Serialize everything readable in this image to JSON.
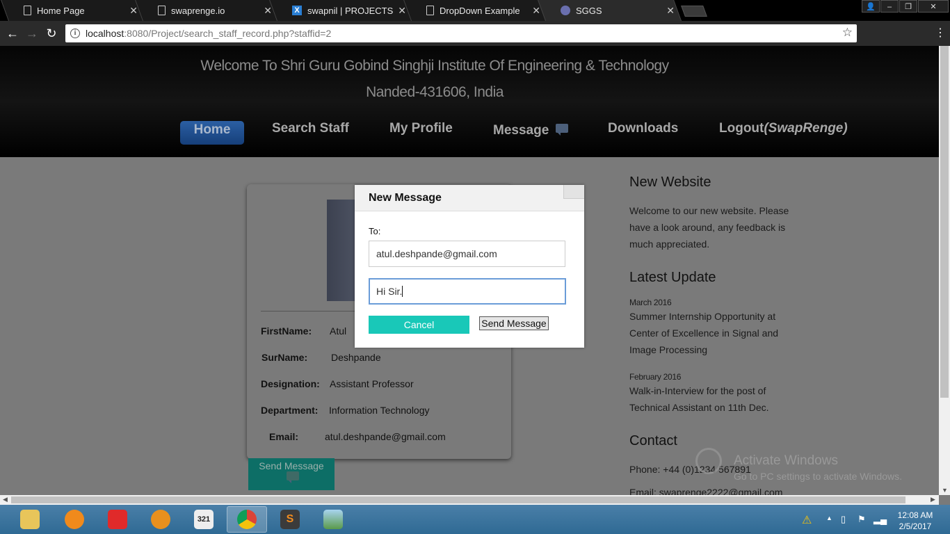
{
  "browser": {
    "tabs": [
      {
        "title": "Home Page",
        "active": false
      },
      {
        "title": "swaprenge.io",
        "active": false
      },
      {
        "title": "swapnil | PROJECTS",
        "active": false
      },
      {
        "title": "DropDown Example",
        "active": false
      },
      {
        "title": "SGGS",
        "active": true
      }
    ],
    "url_host": "localhost",
    "url_rest": ":8080/Project/search_staff_record.php?staffid=2"
  },
  "site": {
    "welcome_line1": "Welcome To Shri Guru Gobind Singhji Institute Of Engineering & Technology",
    "welcome_line2": "Nanded-431606, India",
    "menu": {
      "home": "Home",
      "search_staff": "Search Staff",
      "my_profile": "My Profile",
      "message": "Message",
      "downloads": "Downloads",
      "logout": "Logout",
      "logout_user": "(SwapRenge)"
    }
  },
  "profile": {
    "firstname_label": "FirstName:",
    "firstname": "Atul",
    "surname_label": "SurName:",
    "surname": "Deshpande",
    "designation_label": "Designation:",
    "designation": "Assistant Professor",
    "department_label": "Department:",
    "department": "Information Technology",
    "email_label": "Email:",
    "email": "atul.deshpande@gmail.com",
    "send_message": "Send Message"
  },
  "sidebar": {
    "new_website_title": "New Website",
    "new_website_text": "Welcome to our new website. Please have a look around, any feedback is much appreciated.",
    "latest_update_title": "Latest Update",
    "updates": [
      {
        "date": "March 2016",
        "text": "Summer Internship Opportunity at Center of Excellence in Signal and Image Processing"
      },
      {
        "date": "February 2016",
        "text": "Walk-in-Interview for the post of Technical Assistant on 11th Dec."
      }
    ],
    "contact_title": "Contact",
    "phone": "Phone: +44 (0)1234 567891",
    "email": "Email: swaprenge2222@gmail.com"
  },
  "modal": {
    "title": "New Message",
    "to_label": "To:",
    "to_value": "atul.deshpande@gmail.com",
    "message_value": "Hi Sir.",
    "cancel_label": "Cancel",
    "send_label": "Send Message"
  },
  "watermark": {
    "title": "Activate Windows",
    "subtitle": "Go to PC settings to activate Windows."
  },
  "taskbar": {
    "time": "12:08 AM",
    "date": "2/5/2017"
  }
}
